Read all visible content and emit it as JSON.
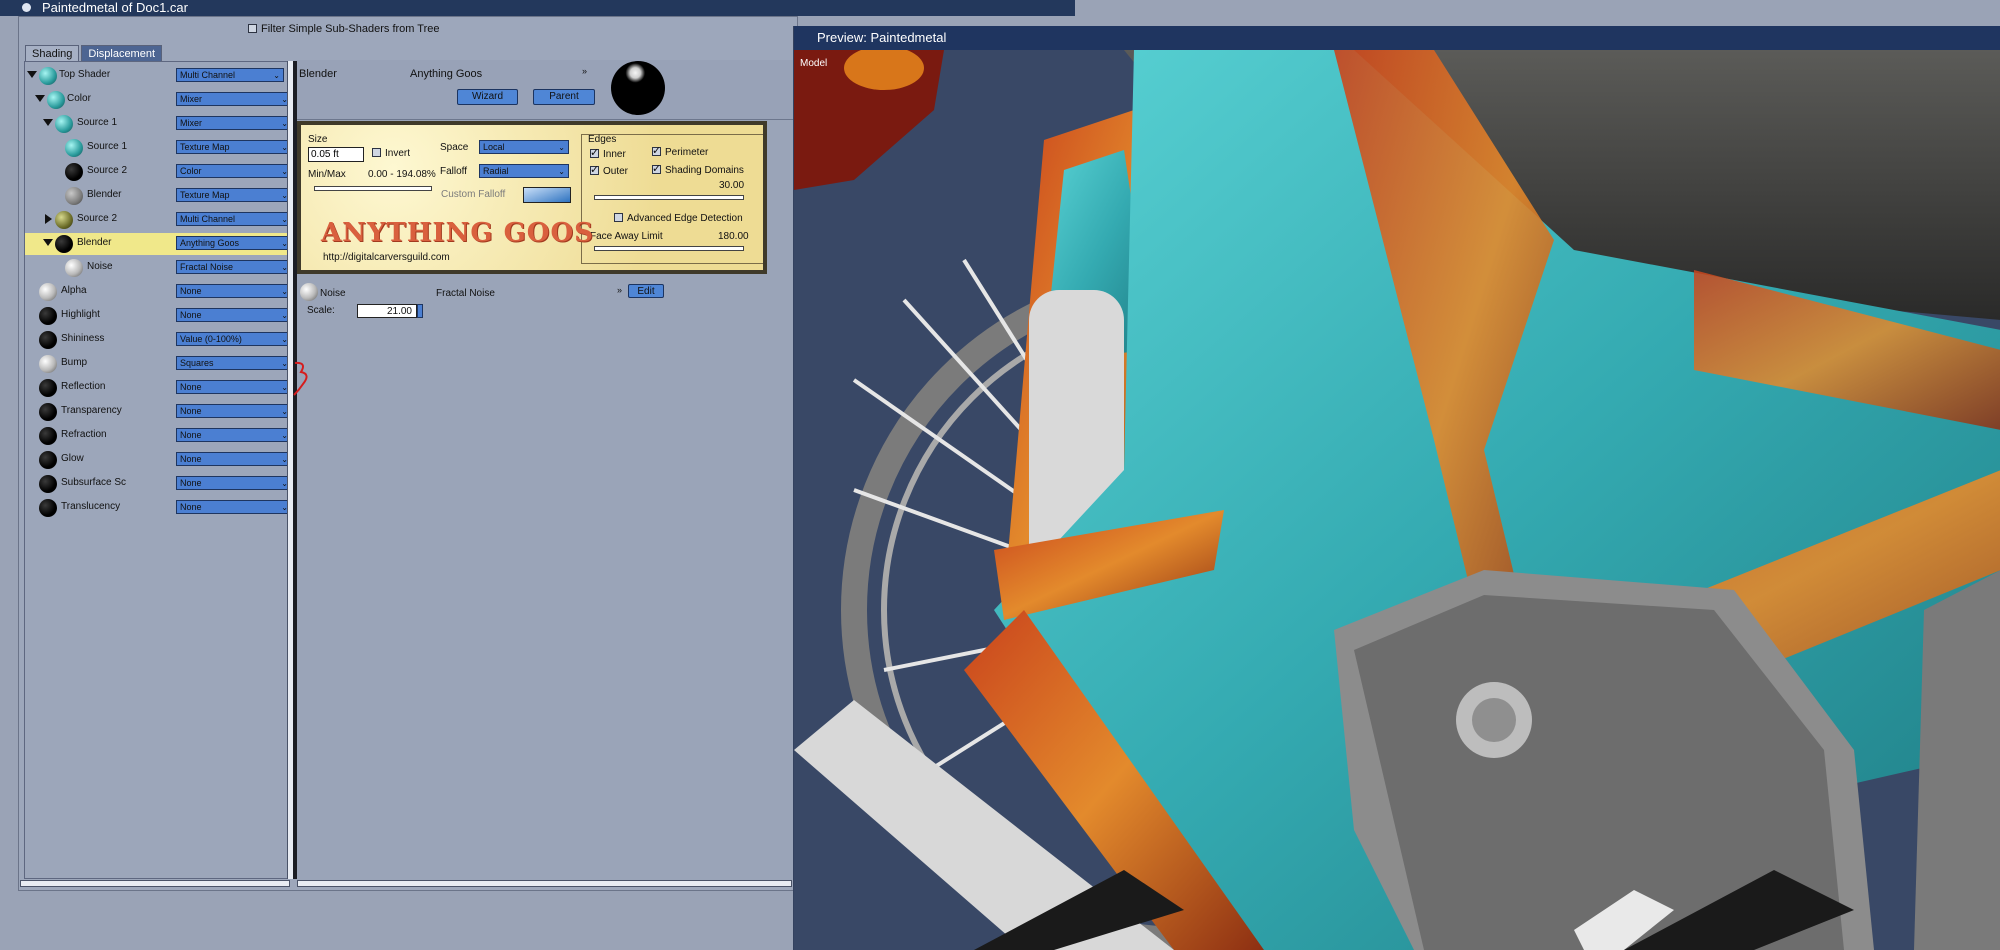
{
  "window": {
    "title": "Paintedmetal of Doc1.car"
  },
  "filter": {
    "label": "Filter Simple Sub-Shaders from Tree"
  },
  "tabs": [
    {
      "label": "Shading"
    },
    {
      "label": "Displacement"
    }
  ],
  "tree": [
    {
      "label": "Top Shader",
      "value": "Multi Channel"
    },
    {
      "label": "Color",
      "value": "Mixer"
    },
    {
      "label": "Source 1",
      "value": "Mixer"
    },
    {
      "label": "Source 1",
      "value": "Texture Map"
    },
    {
      "label": "Source 2",
      "value": "Color"
    },
    {
      "label": "Blender",
      "value": "Texture Map"
    },
    {
      "label": "Source 2",
      "value": "Multi Channel"
    },
    {
      "label": "Blender",
      "value": "Anything Goos"
    },
    {
      "label": "Noise",
      "value": "Fractal Noise"
    },
    {
      "label": "Alpha",
      "value": "None"
    },
    {
      "label": "Highlight",
      "value": "None"
    },
    {
      "label": "Shininess",
      "value": "Value (0-100%)"
    },
    {
      "label": "Bump",
      "value": "Squares"
    },
    {
      "label": "Reflection",
      "value": "None"
    },
    {
      "label": "Transparency",
      "value": "None"
    },
    {
      "label": "Refraction",
      "value": "None"
    },
    {
      "label": "Glow",
      "value": "None"
    },
    {
      "label": "Subsurface Sc",
      "value": "None"
    },
    {
      "label": "Translucency",
      "value": "None"
    }
  ],
  "editor": {
    "channel": "Blender",
    "shader_name": "Anything Goos",
    "wizard_label": "Wizard",
    "parent_label": "Parent"
  },
  "goos": {
    "size_label": "Size",
    "size_value": "0.05 ft",
    "invert_label": "Invert",
    "minmax_label": "Min/Max",
    "minmax_value": "0.00 - 194.08%",
    "space_label": "Space",
    "space_value": "Local",
    "falloff_label": "Falloff",
    "falloff_value": "Radial",
    "custom_falloff_label": "Custom Falloff",
    "edges_label": "Edges",
    "inner_label": "Inner",
    "perimeter_label": "Perimeter",
    "outer_label": "Outer",
    "shading_domains_label": "Shading Domains",
    "edges_value": "30.00",
    "advanced_label": "Advanced Edge Detection",
    "face_away_label": "Face Away Limit",
    "face_away_value": "180.00",
    "logo_text": "ANYTHING GOOS",
    "url": "http://digitalcarversguild.com"
  },
  "noise": {
    "label": "Noise",
    "type": "Fractal Noise",
    "edit_label": "Edit",
    "scale_label": "Scale:",
    "scale_value": "21.00"
  },
  "preview": {
    "title": "Preview: Paintedmetal",
    "mode_label": "Model"
  }
}
